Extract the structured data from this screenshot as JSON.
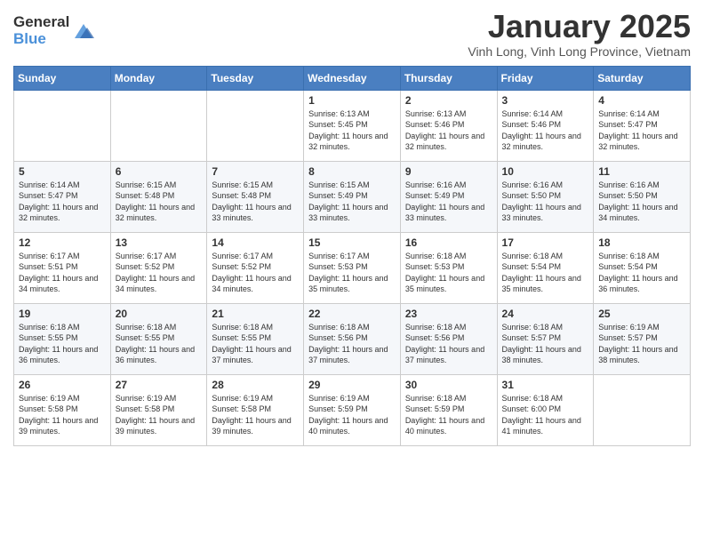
{
  "logo": {
    "general": "General",
    "blue": "Blue"
  },
  "header": {
    "month": "January 2025",
    "location": "Vinh Long, Vinh Long Province, Vietnam"
  },
  "weekdays": [
    "Sunday",
    "Monday",
    "Tuesday",
    "Wednesday",
    "Thursday",
    "Friday",
    "Saturday"
  ],
  "weeks": [
    [
      {
        "day": "",
        "info": ""
      },
      {
        "day": "",
        "info": ""
      },
      {
        "day": "",
        "info": ""
      },
      {
        "day": "1",
        "info": "Sunrise: 6:13 AM\nSunset: 5:45 PM\nDaylight: 11 hours and 32 minutes."
      },
      {
        "day": "2",
        "info": "Sunrise: 6:13 AM\nSunset: 5:46 PM\nDaylight: 11 hours and 32 minutes."
      },
      {
        "day": "3",
        "info": "Sunrise: 6:14 AM\nSunset: 5:46 PM\nDaylight: 11 hours and 32 minutes."
      },
      {
        "day": "4",
        "info": "Sunrise: 6:14 AM\nSunset: 5:47 PM\nDaylight: 11 hours and 32 minutes."
      }
    ],
    [
      {
        "day": "5",
        "info": "Sunrise: 6:14 AM\nSunset: 5:47 PM\nDaylight: 11 hours and 32 minutes."
      },
      {
        "day": "6",
        "info": "Sunrise: 6:15 AM\nSunset: 5:48 PM\nDaylight: 11 hours and 32 minutes."
      },
      {
        "day": "7",
        "info": "Sunrise: 6:15 AM\nSunset: 5:48 PM\nDaylight: 11 hours and 33 minutes."
      },
      {
        "day": "8",
        "info": "Sunrise: 6:15 AM\nSunset: 5:49 PM\nDaylight: 11 hours and 33 minutes."
      },
      {
        "day": "9",
        "info": "Sunrise: 6:16 AM\nSunset: 5:49 PM\nDaylight: 11 hours and 33 minutes."
      },
      {
        "day": "10",
        "info": "Sunrise: 6:16 AM\nSunset: 5:50 PM\nDaylight: 11 hours and 33 minutes."
      },
      {
        "day": "11",
        "info": "Sunrise: 6:16 AM\nSunset: 5:50 PM\nDaylight: 11 hours and 34 minutes."
      }
    ],
    [
      {
        "day": "12",
        "info": "Sunrise: 6:17 AM\nSunset: 5:51 PM\nDaylight: 11 hours and 34 minutes."
      },
      {
        "day": "13",
        "info": "Sunrise: 6:17 AM\nSunset: 5:52 PM\nDaylight: 11 hours and 34 minutes."
      },
      {
        "day": "14",
        "info": "Sunrise: 6:17 AM\nSunset: 5:52 PM\nDaylight: 11 hours and 34 minutes."
      },
      {
        "day": "15",
        "info": "Sunrise: 6:17 AM\nSunset: 5:53 PM\nDaylight: 11 hours and 35 minutes."
      },
      {
        "day": "16",
        "info": "Sunrise: 6:18 AM\nSunset: 5:53 PM\nDaylight: 11 hours and 35 minutes."
      },
      {
        "day": "17",
        "info": "Sunrise: 6:18 AM\nSunset: 5:54 PM\nDaylight: 11 hours and 35 minutes."
      },
      {
        "day": "18",
        "info": "Sunrise: 6:18 AM\nSunset: 5:54 PM\nDaylight: 11 hours and 36 minutes."
      }
    ],
    [
      {
        "day": "19",
        "info": "Sunrise: 6:18 AM\nSunset: 5:55 PM\nDaylight: 11 hours and 36 minutes."
      },
      {
        "day": "20",
        "info": "Sunrise: 6:18 AM\nSunset: 5:55 PM\nDaylight: 11 hours and 36 minutes."
      },
      {
        "day": "21",
        "info": "Sunrise: 6:18 AM\nSunset: 5:55 PM\nDaylight: 11 hours and 37 minutes."
      },
      {
        "day": "22",
        "info": "Sunrise: 6:18 AM\nSunset: 5:56 PM\nDaylight: 11 hours and 37 minutes."
      },
      {
        "day": "23",
        "info": "Sunrise: 6:18 AM\nSunset: 5:56 PM\nDaylight: 11 hours and 37 minutes."
      },
      {
        "day": "24",
        "info": "Sunrise: 6:18 AM\nSunset: 5:57 PM\nDaylight: 11 hours and 38 minutes."
      },
      {
        "day": "25",
        "info": "Sunrise: 6:19 AM\nSunset: 5:57 PM\nDaylight: 11 hours and 38 minutes."
      }
    ],
    [
      {
        "day": "26",
        "info": "Sunrise: 6:19 AM\nSunset: 5:58 PM\nDaylight: 11 hours and 39 minutes."
      },
      {
        "day": "27",
        "info": "Sunrise: 6:19 AM\nSunset: 5:58 PM\nDaylight: 11 hours and 39 minutes."
      },
      {
        "day": "28",
        "info": "Sunrise: 6:19 AM\nSunset: 5:58 PM\nDaylight: 11 hours and 39 minutes."
      },
      {
        "day": "29",
        "info": "Sunrise: 6:19 AM\nSunset: 5:59 PM\nDaylight: 11 hours and 40 minutes."
      },
      {
        "day": "30",
        "info": "Sunrise: 6:18 AM\nSunset: 5:59 PM\nDaylight: 11 hours and 40 minutes."
      },
      {
        "day": "31",
        "info": "Sunrise: 6:18 AM\nSunset: 6:00 PM\nDaylight: 11 hours and 41 minutes."
      },
      {
        "day": "",
        "info": ""
      }
    ]
  ]
}
